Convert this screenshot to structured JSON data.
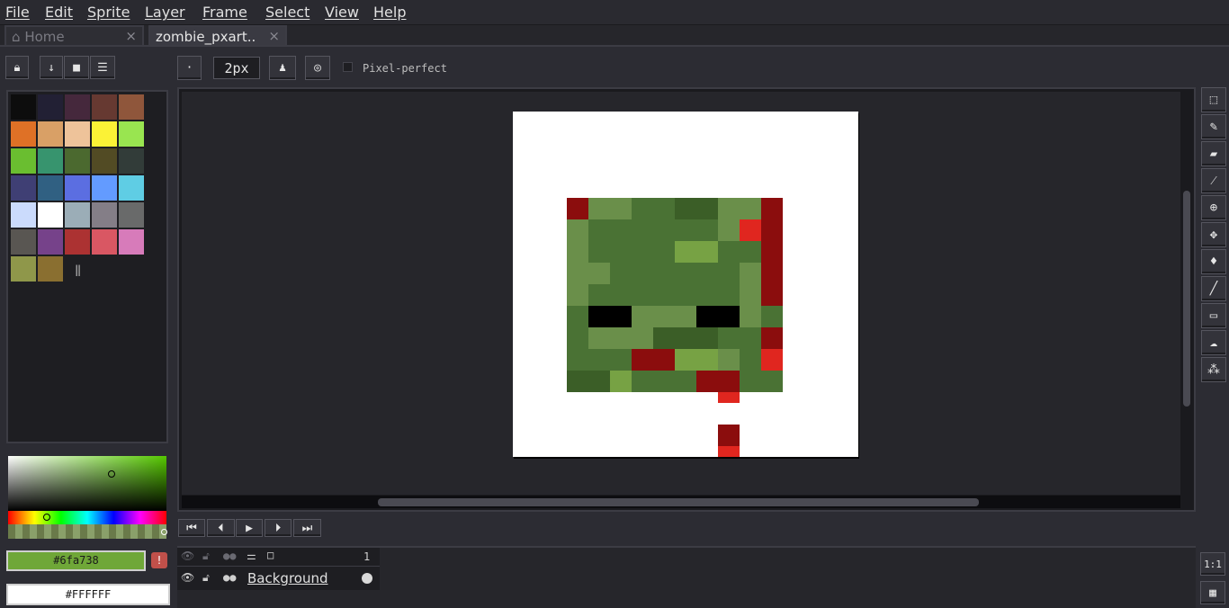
{
  "menu": [
    "File",
    "Edit",
    "Sprite",
    "Layer",
    "Frame",
    "Select",
    "View",
    "Help"
  ],
  "tabs": {
    "home": "Home",
    "active": "zombie_pxart..",
    "close": "×"
  },
  "toolbar": {
    "brush_size": "2px",
    "pixel_perfect": "Pixel-perfect"
  },
  "colors": {
    "fg_hex": "#6fa738",
    "bg_hex": "#FFFFFF",
    "palette": [
      "#0d0d0d",
      "#222034",
      "#45283c",
      "#663931",
      "#8f563b",
      "#df7126",
      "#d9a066",
      "#eec39a",
      "#fbf236",
      "#99e550",
      "#6abe30",
      "#37946e",
      "#4b692f",
      "#524b24",
      "#323c39",
      "#3f3f74",
      "#306082",
      "#5b6ee1",
      "#639bff",
      "#5fcde4",
      "#cbdbfc",
      "#ffffff",
      "#9badb7",
      "#847e87",
      "#696a6a",
      "#595652",
      "#76428a",
      "#ac3232",
      "#d95763",
      "#d77bba",
      "#8f974a",
      "#8a6f30"
    ]
  },
  "layers": {
    "frame_number": "1",
    "layer_name": "Background"
  },
  "zoom_label": "1:1"
}
